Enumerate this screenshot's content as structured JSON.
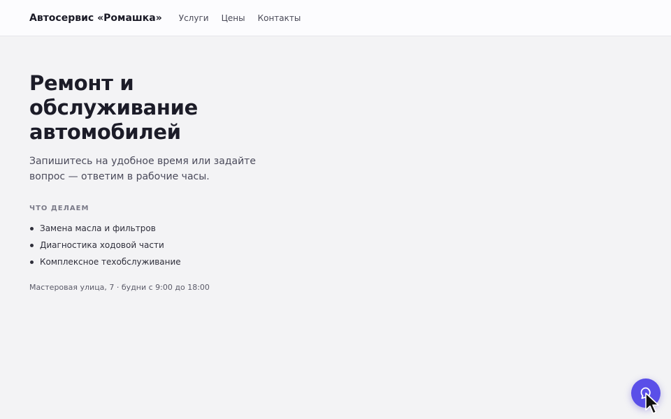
{
  "header": {
    "brand": "Автосервис «Ромашка»",
    "nav": [
      {
        "label": "Услуги"
      },
      {
        "label": "Цены"
      },
      {
        "label": "Контакты"
      }
    ]
  },
  "hero": {
    "title": "Ремонт и обслуживание автомобилей",
    "subtitle": "Запишитесь на удобное время или задайте вопрос — ответим в рабочие часы.",
    "section_label": "ЧТО ДЕЛАЕМ",
    "services": [
      "Замена масла и фильтров",
      "Диагностика ходовой части",
      "Комплексное техобслуживание"
    ],
    "address": "Мастеровая улица, 7 · будни с 9:00 до 18:00"
  },
  "chat_widget": {
    "icon": "chat-bubble-icon",
    "accent_color": "#5a4fe8"
  }
}
